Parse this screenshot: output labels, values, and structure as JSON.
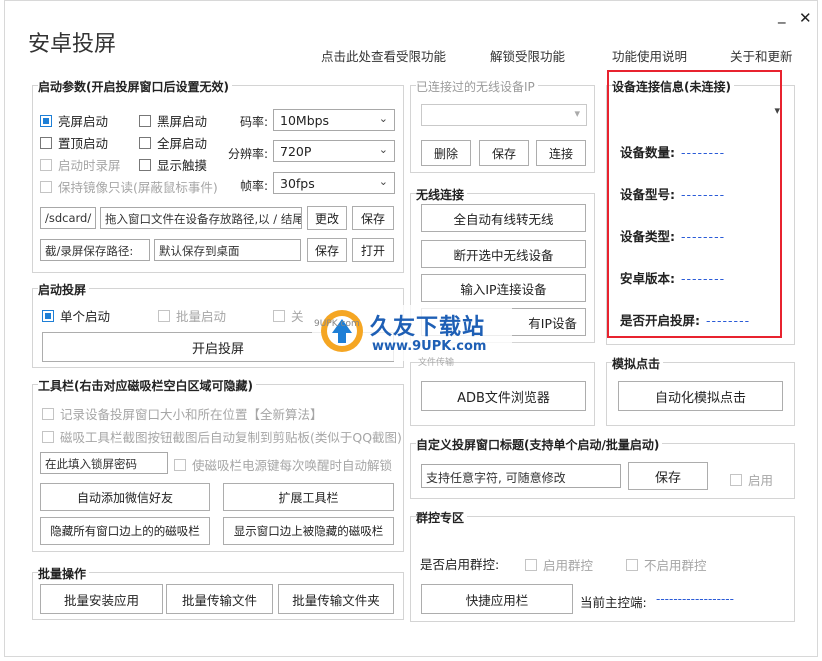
{
  "app": {
    "title": "安卓投屏"
  },
  "topmenu": [
    "点击此处查看受限功能",
    "解锁受限功能",
    "功能使用说明",
    "关于和更新"
  ],
  "window_controls": {
    "minimize": "_",
    "close": "✕"
  },
  "startup": {
    "title": "启动参数(开启投屏窗口后设置无效)",
    "checks": [
      {
        "label": "亮屏启动",
        "checked": true,
        "disabled": false
      },
      {
        "label": "黑屏启动",
        "checked": false,
        "disabled": false
      },
      {
        "label": "置顶启动",
        "checked": false,
        "disabled": false
      },
      {
        "label": "全屏启动",
        "checked": false,
        "disabled": false
      },
      {
        "label": "启动时录屏",
        "checked": false,
        "disabled": true
      },
      {
        "label": "显示触摸",
        "checked": false,
        "disabled": false
      },
      {
        "label": "保持镜像只读(屏蔽鼠标事件)",
        "checked": false,
        "disabled": true
      }
    ],
    "bitrate_label": "码率:",
    "bitrate_value": "10Mbps",
    "resolution_label": "分辨率:",
    "resolution_value": "720P",
    "framerate_label": "帧率:",
    "framerate_value": "30fps",
    "sdcard_path": "/sdcard/",
    "drag_hint": "拖入窗口文件在设备存放路径,以 / 结尾",
    "modify_btn": "更改",
    "save_btn": "保存",
    "capture_label": "截/录屏保存路径:",
    "capture_value": "默认保存到桌面",
    "capture_save_btn": "保存",
    "capture_open_btn": "打开"
  },
  "launch": {
    "title": "启动投屏",
    "single": "单个启动",
    "batch": "批量启动",
    "third": "关",
    "start_btn": "开启投屏"
  },
  "toolbar": {
    "title": "工具栏(右击对应磁吸栏空白区域可隐藏)",
    "check1": "记录设备投屏窗口大小和所在位置【全新算法】",
    "check2": "磁吸工具栏截图按钮截图后自动复制到剪贴板(类似于QQ截图)",
    "password_placeholder": "在此填入锁屏密码",
    "check3": "使磁吸栏电源键每次唤醒时自动解锁",
    "btn_wechat": "自动添加微信好友",
    "btn_extend": "扩展工具栏",
    "btn_hide": "隐藏所有窗口边上的的磁吸栏",
    "btn_show": "显示窗口边上被隐藏的磁吸栏"
  },
  "batch": {
    "title": "批量操作",
    "btn_install": "批量安装应用",
    "btn_files": "批量传输文件",
    "btn_folder": "批量传输文件夹"
  },
  "wireless_history": {
    "title": "已连接过的无线设备IP",
    "delete_btn": "删除",
    "save_btn": "保存",
    "connect_btn": "连接"
  },
  "wireless": {
    "title": "无线连接",
    "btn1": "全自动有线转无线",
    "btn2": "断开选中无线设备",
    "btn3": "输入IP连接设备",
    "btn4": "有IP设备"
  },
  "adb": {
    "btn": "ADB文件浏览器"
  },
  "sim_click": {
    "title": "模拟点击",
    "btn": "自动化模拟点击"
  },
  "custom_title": {
    "title": "自定义投屏窗口标题(支持单个启动/批量启动)",
    "placeholder": "支持任意字符, 可随意修改",
    "save_btn": "保存",
    "enable": "启用"
  },
  "group_control": {
    "title": "群控专区",
    "question": "是否启用群控:",
    "enable": "启用群控",
    "disable": "不启用群控",
    "quick_btn": "快捷应用栏",
    "master_label": "当前主控端:",
    "master_value": "------------------"
  },
  "device_info": {
    "title": "设备连接信息(未连接)",
    "rows": [
      {
        "label": "设备数量:",
        "value": "--------"
      },
      {
        "label": "设备型号:",
        "value": "--------"
      },
      {
        "label": "设备类型:",
        "value": "--------"
      },
      {
        "label": "安卓版本:",
        "value": "--------"
      },
      {
        "label": "是否开启投屏:",
        "value": "--------"
      }
    ]
  },
  "watermark": {
    "name": "久友下载站",
    "url": "www.9UPK.com",
    "sub": "9UPK.com",
    "tag": "文件传输"
  },
  "colors": {
    "accent": "#1e7fd6",
    "highlight_border": "#e8232f",
    "value_blue": "#2a5bd7"
  }
}
